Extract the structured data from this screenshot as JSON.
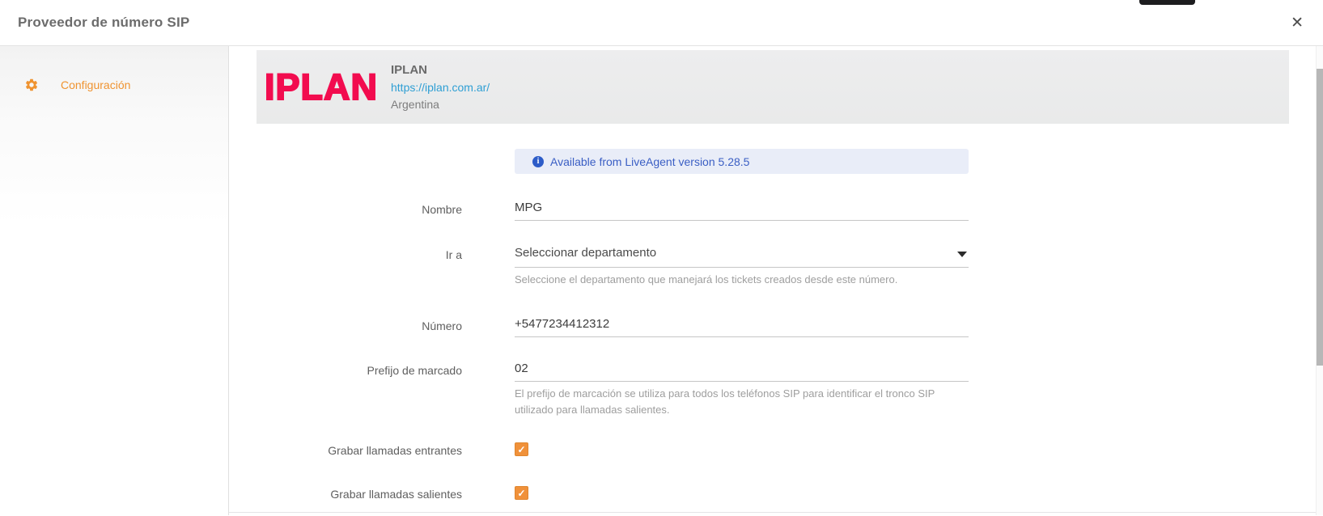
{
  "dialog": {
    "title": "Proveedor de número SIP",
    "close_glyph": "✕"
  },
  "sidebar": {
    "items": [
      {
        "label": "Configuración",
        "icon": "gear-icon",
        "active": true
      }
    ]
  },
  "provider": {
    "logo_text": "IPLAN",
    "name": "IPLAN",
    "url": "https://iplan.com.ar/",
    "country": "Argentina"
  },
  "notice": {
    "icon_glyph": "i",
    "text": "Available from LiveAgent version 5.28.5"
  },
  "form": {
    "nombre": {
      "label": "Nombre",
      "value": "MPG"
    },
    "ir_a": {
      "label": "Ir a",
      "value": "Seleccionar departamento",
      "helper": "Seleccione el departamento que manejará los tickets creados desde este número."
    },
    "numero": {
      "label": "Número",
      "value": "+5477234412312"
    },
    "prefijo": {
      "label": "Prefijo de marcado",
      "value": "02",
      "helper": "El prefijo de marcación se utiliza para todos los teléfonos SIP para identificar el tronco SIP utilizado para llamadas salientes."
    },
    "grabar_entrantes": {
      "label": "Grabar llamadas entrantes",
      "checked": true
    },
    "grabar_salientes": {
      "label": "Grabar llamadas salientes",
      "checked": true
    }
  },
  "icons": {
    "check": "✓"
  },
  "colors": {
    "accent_orange": "#ef9330",
    "checkbox_orange": "#f0913a",
    "brand_pink": "#f20c4f",
    "link_blue": "#2e9fd4",
    "notice_text_blue": "#3a5ec4",
    "notice_bg": "#e9edf8",
    "header_gray": "#ececed"
  }
}
